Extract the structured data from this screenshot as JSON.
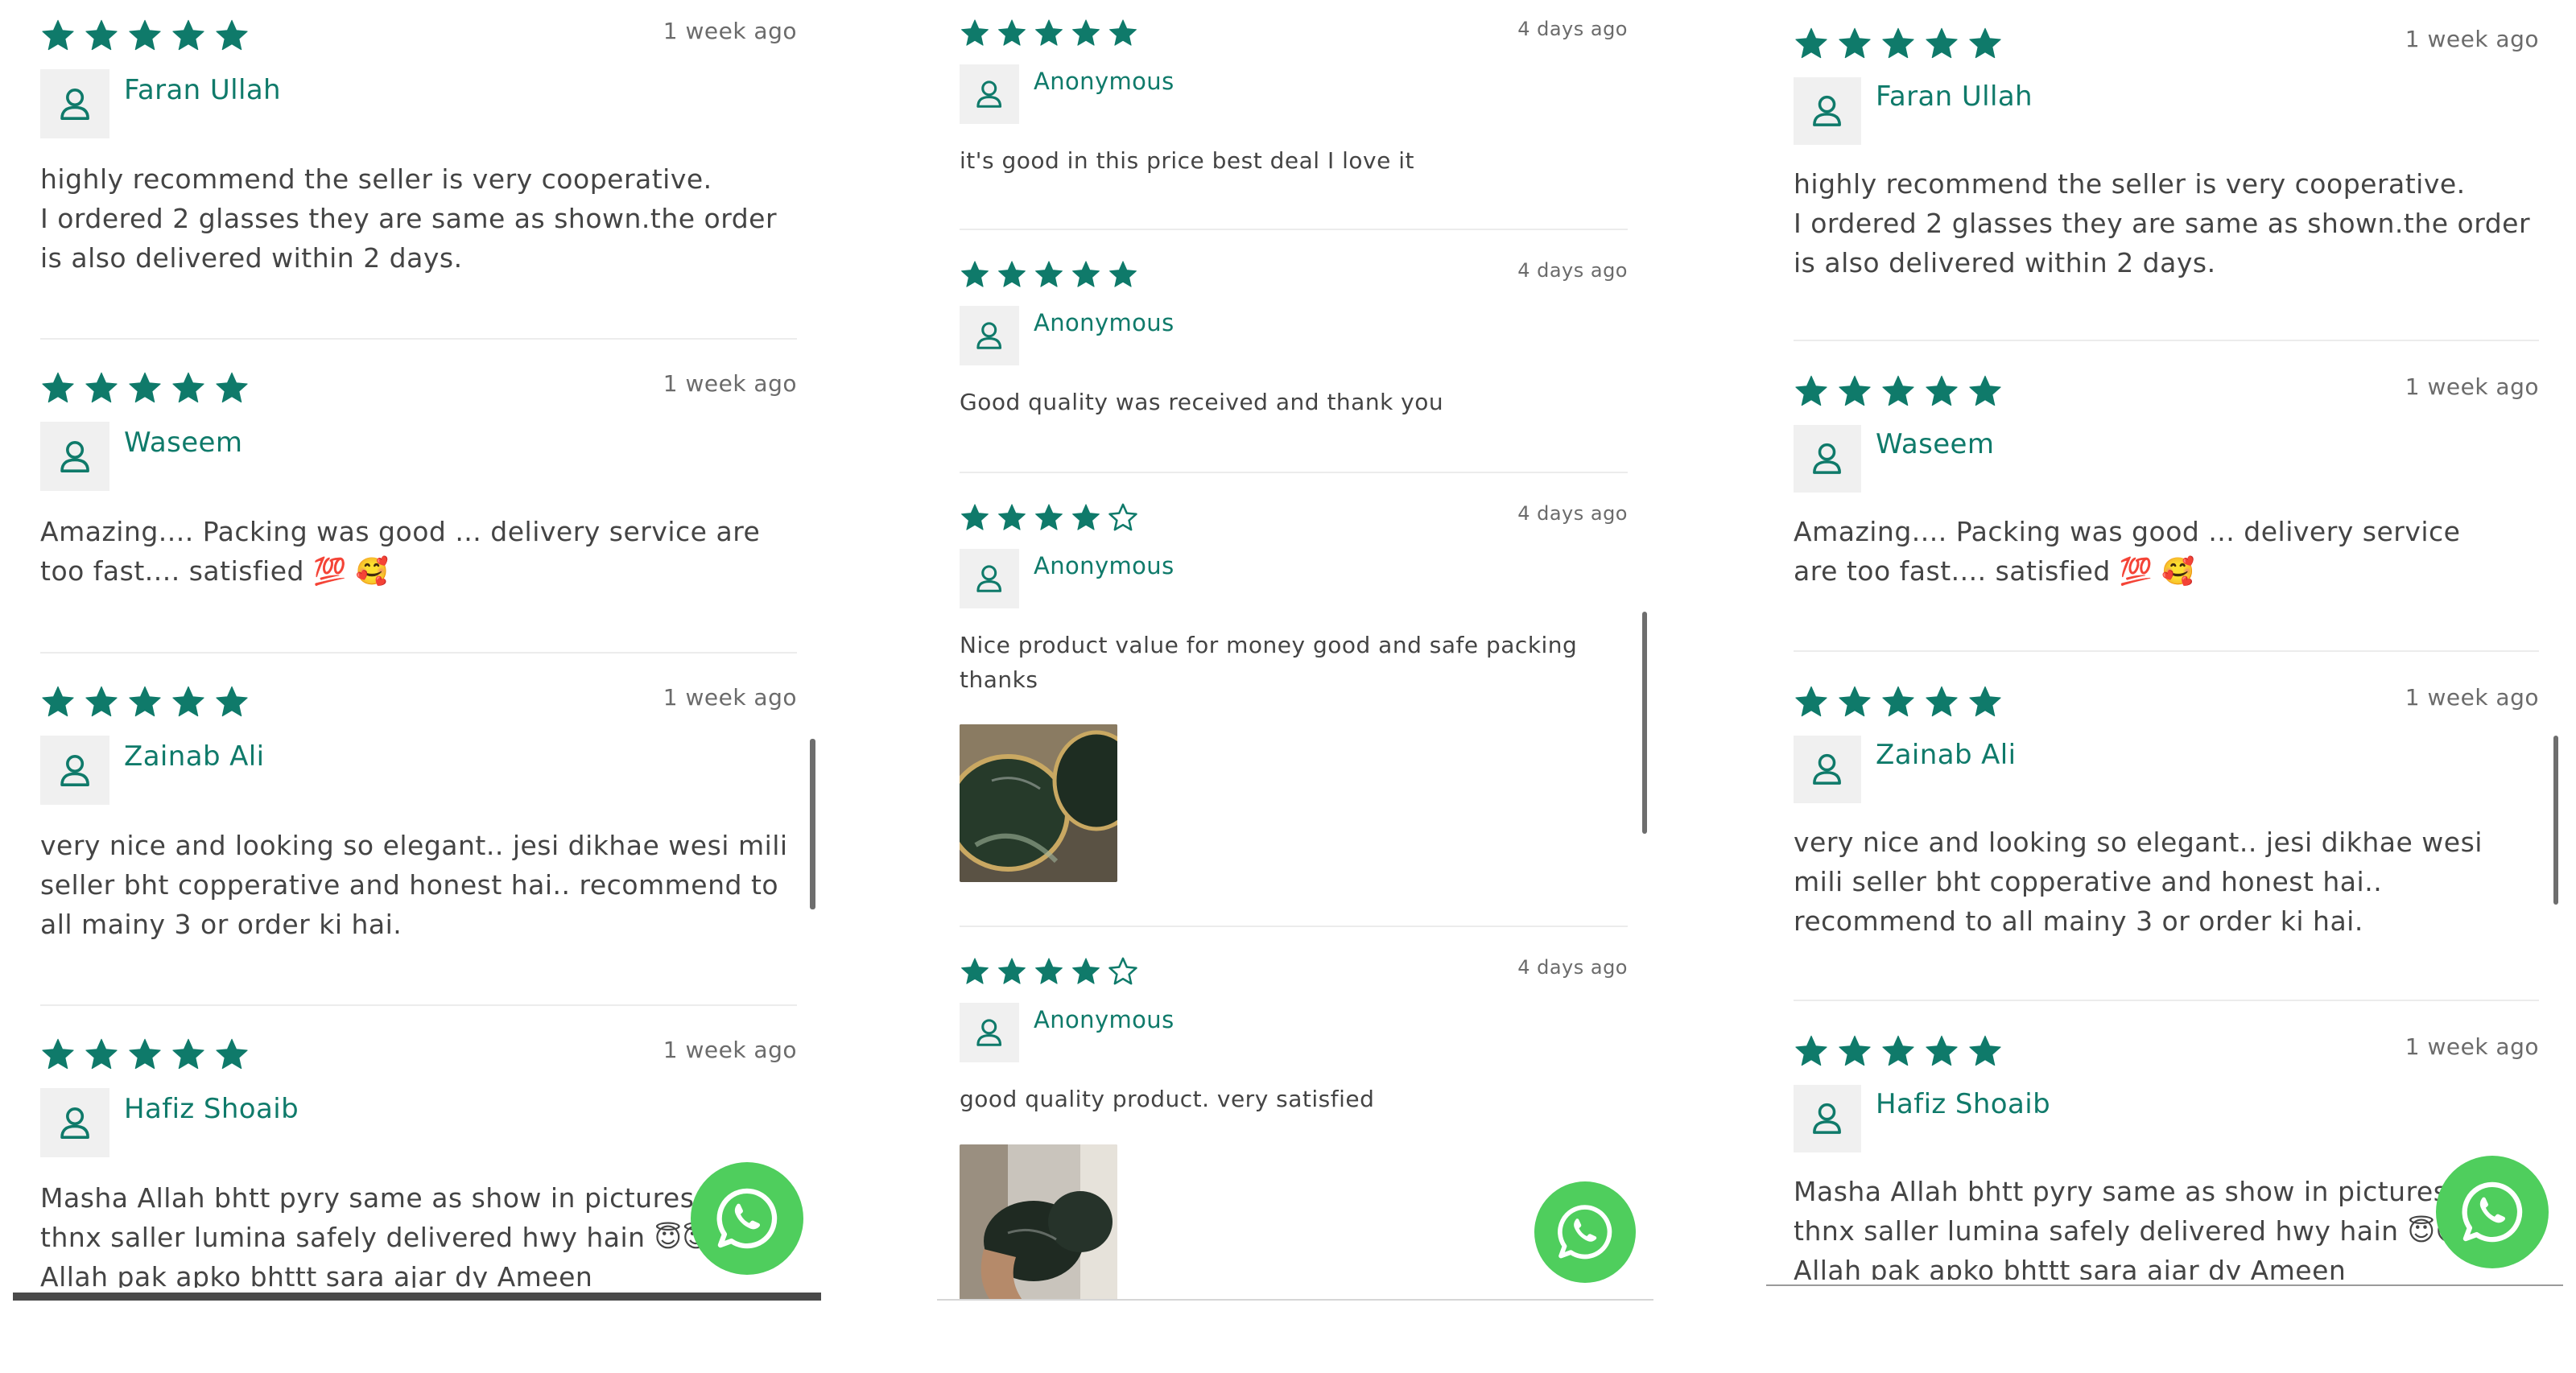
{
  "colors": {
    "accent": "#0f7a6a",
    "whatsapp": "#4fce5d",
    "star": "#0f7a6a"
  },
  "columns": [
    {
      "reviews": [
        {
          "rating": 5,
          "date": "1 week ago",
          "name": "Faran Ullah",
          "text": "highly recommend the seller is very cooperative.\nI ordered 2 glasses they are same as shown.the order is also delivered within 2 days."
        },
        {
          "rating": 5,
          "date": "1 week ago",
          "name": "Waseem",
          "text": "Amazing.... Packing was good ... delivery service are too fast.... satisfied 💯 🥰"
        },
        {
          "rating": 5,
          "date": "1 week ago",
          "name": "Zainab Ali",
          "text": "very nice and looking so elegant.. jesi dikhae wesi mili seller bht copperative and honest hai.. recommend to all mainy 3 or order ki hai."
        },
        {
          "rating": 5,
          "date": "1 week ago",
          "name": "Hafiz Shoaib",
          "text": "Masha Allah bhtt pyry same as show in pictures\nthnx saller lumina safely delivered hwy hain 😇😇\nAllah pak apko bhttt sara ajar dy Ameen"
        }
      ]
    },
    {
      "reviews": [
        {
          "rating": 5,
          "date": "4 days ago",
          "name": "Anonymous",
          "text": "it's good in this price best deal I love it"
        },
        {
          "rating": 5,
          "date": "4 days ago",
          "name": "Anonymous",
          "text": "Good quality was received and thank you"
        },
        {
          "rating": 4,
          "date": "4 days ago",
          "name": "Anonymous",
          "text": "Nice product value for money good and safe packing thanks"
        },
        {
          "rating": 4,
          "date": "4 days ago",
          "name": "Anonymous",
          "text": "good quality product. very satisfied"
        }
      ]
    },
    {
      "reviews": [
        {
          "rating": 5,
          "date": "1 week ago",
          "name": "Faran Ullah",
          "text": "highly recommend the seller is very cooperative.\nI ordered 2 glasses they are same as shown.the order is also delivered within 2 days."
        },
        {
          "rating": 5,
          "date": "1 week ago",
          "name": "Waseem",
          "text": "Amazing.... Packing was good ... delivery service are too fast.... satisfied 💯 🥰"
        },
        {
          "rating": 5,
          "date": "1 week ago",
          "name": "Zainab Ali",
          "text": "very nice and looking so elegant.. jesi dikhae wesi mili seller bht copperative and honest hai.. recommend to all mainy 3 or order ki hai."
        },
        {
          "rating": 5,
          "date": "1 week ago",
          "name": "Hafiz Shoaib",
          "text": "Masha Allah bhtt pyry same as show in pictures\nthnx saller lumina safely delivered hwy hain 😇😇\nAllah pak apko bhttt sara ajar dy Ameen"
        }
      ]
    }
  ]
}
